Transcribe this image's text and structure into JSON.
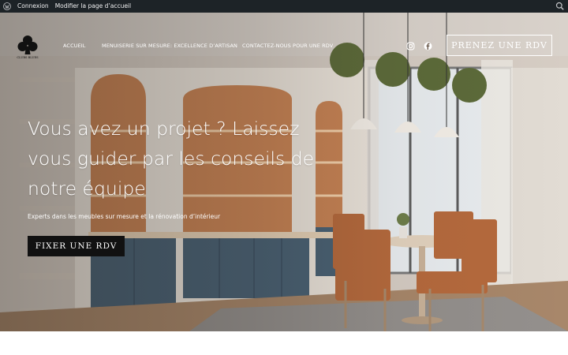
{
  "admin_bar": {
    "wp_icon": "wordpress-logo-icon",
    "login": "Connexion",
    "edit_home": "Modifier la page d’accueil",
    "search_icon": "search-icon"
  },
  "header": {
    "logo_icon": "club-logo-icon",
    "logo_text": "CLUBS BLUES",
    "nav": [
      "ACCUEIL",
      "MENUISERIE SUR MESURE: EXCELLENCE D’ARTISAN",
      "CONTACTEZ-NOUS POUR UNE RDV"
    ],
    "social": [
      "instagram-icon",
      "facebook-icon"
    ],
    "cta": "PRENEZ UNE RDV"
  },
  "hero": {
    "title": "Vous avez un projet ? Laissez vous guider par les conseils de notre équipe",
    "subtitle": "Experts dans les meubles sur mesure et la rénovation d’intérieur",
    "button": "FIXER UNE RDV"
  }
}
